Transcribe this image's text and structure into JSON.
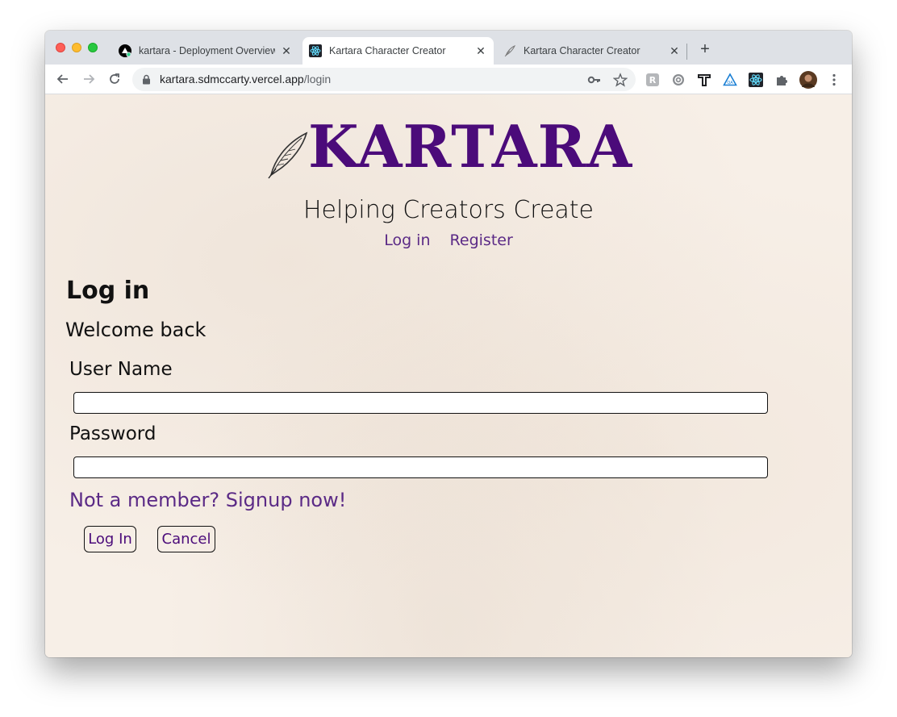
{
  "browser": {
    "tabs": [
      {
        "title": "kartara - Deployment Overview",
        "icon": "vercel-icon",
        "active": false
      },
      {
        "title": "Kartara Character Creator",
        "icon": "react-icon",
        "active": true
      },
      {
        "title": "Kartara Character Creator",
        "icon": "quill-icon",
        "active": false
      }
    ],
    "new_tab_label": "+",
    "close_glyph": "✕",
    "url_domain": "kartara.sdmccarty.vercel.app",
    "url_path": "/login"
  },
  "site": {
    "logo_text": "KARTARA",
    "tagline": "Helping Creators Create",
    "nav": {
      "login": "Log in",
      "register": "Register"
    }
  },
  "form": {
    "heading": "Log in",
    "subheading": "Welcome back",
    "username_label": "User Name",
    "username_value": "",
    "password_label": "Password",
    "password_value": "",
    "signup_link": "Not a member? Signup now!",
    "login_button": "Log In",
    "cancel_button": "Cancel"
  },
  "colors": {
    "brand": "#4b0b7a",
    "link": "#5b2a86",
    "page_bg": "#f7efe7"
  }
}
